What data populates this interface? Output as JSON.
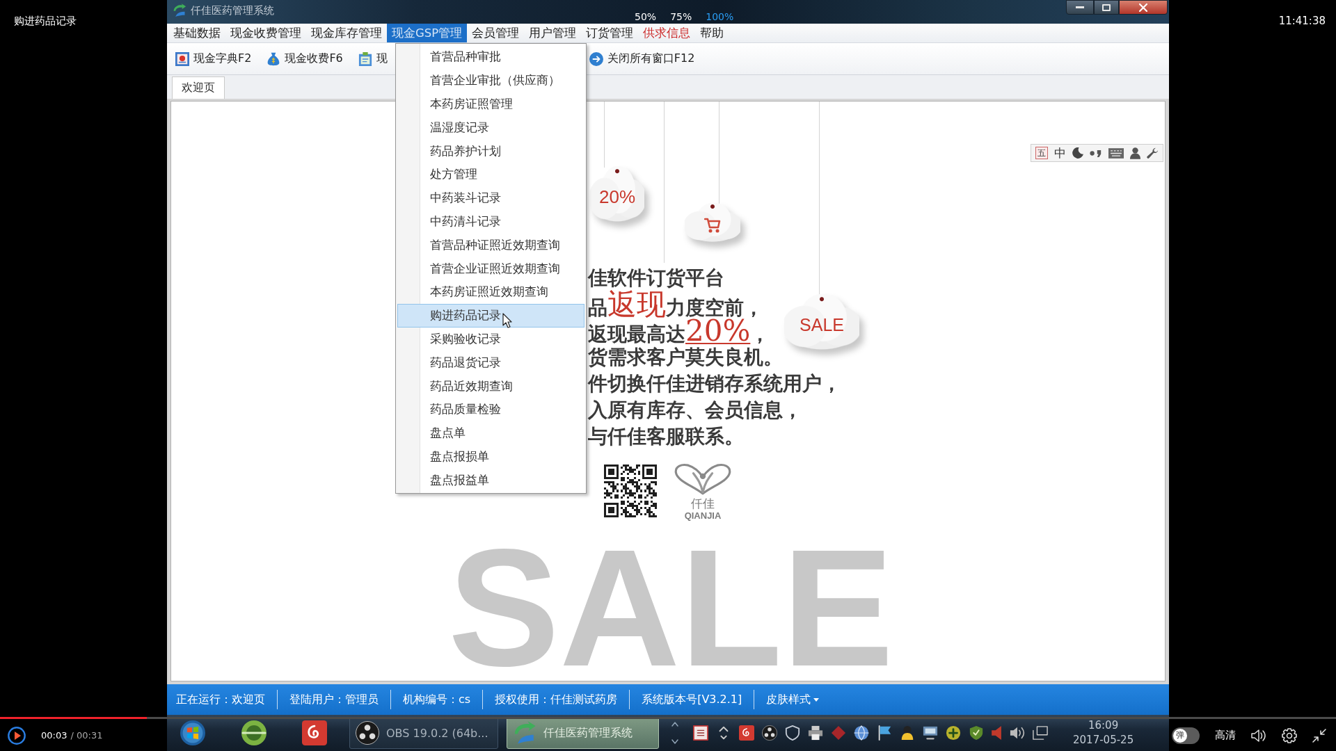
{
  "player": {
    "title": "购进药品记录",
    "clock": "11:41:38",
    "zoom_options": [
      {
        "label": "50%",
        "selected": false
      },
      {
        "label": "75%",
        "selected": false
      },
      {
        "label": "100%",
        "selected": true
      }
    ],
    "elapsed": "00:03",
    "total": "/ 00:31",
    "progress": {
      "level": 0.11
    },
    "danmaku": {
      "label": "弹",
      "on": false
    },
    "quality": "高清"
  },
  "window": {
    "title": "仟佳医药管理系统"
  },
  "menu_bar": [
    {
      "label": "基础数据",
      "selected": false,
      "emphasized": false
    },
    {
      "label": "现金收费管理",
      "selected": false,
      "emphasized": false
    },
    {
      "label": "现金库存管理",
      "selected": false,
      "emphasized": false
    },
    {
      "label": "现金GSP管理",
      "selected": true,
      "emphasized": false
    },
    {
      "label": "会员管理",
      "selected": false,
      "emphasized": false
    },
    {
      "label": "用户管理",
      "selected": false,
      "emphasized": false
    },
    {
      "label": "订货管理",
      "selected": false,
      "emphasized": false
    },
    {
      "label": "供求信息",
      "selected": false,
      "emphasized": true
    },
    {
      "label": "帮助",
      "selected": false,
      "emphasized": false
    }
  ],
  "toolbar": [
    {
      "label": "现金字典F2"
    },
    {
      "label": "现金收费F6"
    },
    {
      "label": "现"
    },
    {
      "label": "关闭所有窗口F12"
    }
  ],
  "gsp_menu": [
    {
      "label": "首营品种审批",
      "selected": false
    },
    {
      "label": "首营企业审批（供应商）",
      "selected": false
    },
    {
      "label": "本药房证照管理",
      "selected": false
    },
    {
      "label": "温湿度记录",
      "selected": false
    },
    {
      "label": "药品养护计划",
      "selected": false
    },
    {
      "label": "处方管理",
      "selected": false
    },
    {
      "label": "中药装斗记录",
      "selected": false
    },
    {
      "label": "中药清斗记录",
      "selected": false
    },
    {
      "label": "首营品种证照近效期查询",
      "selected": false
    },
    {
      "label": "首营企业证照近效期查询",
      "selected": false
    },
    {
      "label": "本药房证照近效期查询",
      "selected": false
    },
    {
      "label": "购进药品记录",
      "selected": true
    },
    {
      "label": "采购验收记录",
      "selected": false
    },
    {
      "label": "药品退货记录",
      "selected": false
    },
    {
      "label": "药品近效期查询",
      "selected": false
    },
    {
      "label": "药品质量检验",
      "selected": false
    },
    {
      "label": "盘点单",
      "selected": false
    },
    {
      "label": "盘点报损单",
      "selected": false
    },
    {
      "label": "盘点报益单",
      "selected": false
    }
  ],
  "tabs": [
    {
      "label": "欢迎页",
      "selected": true
    }
  ],
  "ime_bar": {
    "mode": "五",
    "language": "中"
  },
  "banner": {
    "clouds": [
      {
        "kind": "text",
        "label": "20%"
      },
      {
        "kind": "cart"
      },
      {
        "kind": "text",
        "label": "SALE"
      }
    ],
    "lines": [
      [
        {
          "text": "佳软件订货平台",
          "kind": "plain"
        }
      ],
      [
        {
          "text": "品",
          "kind": "plain"
        },
        {
          "text": "返现",
          "kind": "highlight"
        },
        {
          "text": "力度空前，",
          "kind": "plain"
        }
      ],
      [
        {
          "text": "返现最高达",
          "kind": "plain"
        },
        {
          "text": "20%",
          "kind": "underlined"
        },
        {
          "text": "，",
          "kind": "plain"
        }
      ],
      [
        {
          "text": "货需求客户莫失良机。",
          "kind": "plain"
        }
      ],
      [
        {
          "text": "件切换仟佳进销存系统用户，",
          "kind": "plain"
        }
      ],
      [
        {
          "text": "入原有库存、会员信息，",
          "kind": "plain"
        }
      ],
      [
        {
          "text": "与仟佳客服联系。",
          "kind": "plain"
        }
      ]
    ],
    "logo": {
      "name": "仟佳",
      "latin": "QIANJIA"
    },
    "backdrop_word": "SALE"
  },
  "status_bar": [
    {
      "kind": "info",
      "text": "正在运行：欢迎页"
    },
    {
      "kind": "info",
      "text": "登陆用户：管理员"
    },
    {
      "kind": "info",
      "text": "机构编号：cs"
    },
    {
      "kind": "info",
      "text": "授权使用：仟佳测试药房"
    },
    {
      "kind": "info",
      "text": "系统版本号[V3.2.1]"
    },
    {
      "kind": "dropdown",
      "text": "皮肤样式"
    }
  ],
  "taskbar": {
    "buttons": [
      {
        "label": "OBS 19.0.2 (64b...",
        "selected": false
      },
      {
        "label": "仟佳医药管理系统",
        "selected": true
      }
    ],
    "time": "16:09",
    "date": "2017-05-25"
  }
}
